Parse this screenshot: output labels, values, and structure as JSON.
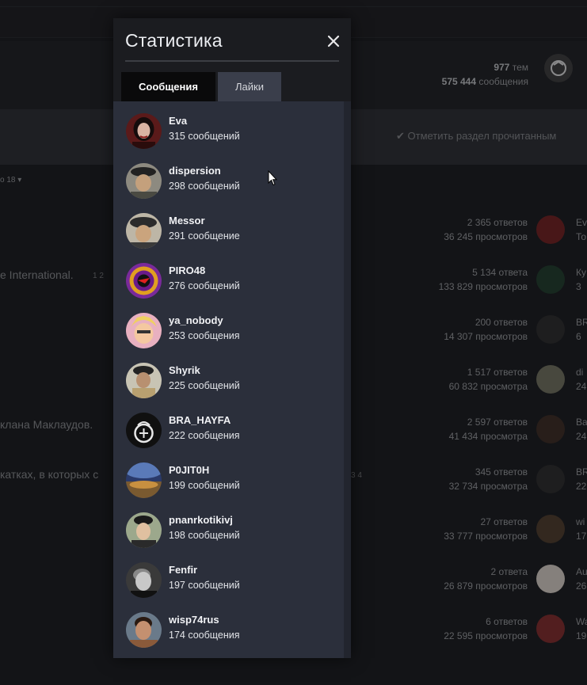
{
  "background": {
    "forum_stats": {
      "topics_value": "977",
      "topics_label": "тем",
      "posts_value": "575 444",
      "posts_label": "сообщения"
    },
    "mark_read": "✔ Отметить раздел прочитанным",
    "sort_fragment": "о 18 ▾",
    "rows": [
      {
        "title": "",
        "pages": "",
        "replies": "2 365 ответов",
        "views": "36 245 просмотров",
        "user": "Ev",
        "sub": "То"
      },
      {
        "title": "e International.",
        "pages": "1  2",
        "replies": "5 134 ответа",
        "views": "133 829 просмотров",
        "user": "Ку",
        "sub": "3"
      },
      {
        "title": "",
        "pages": "",
        "replies": "200 ответов",
        "views": "14 307 просмотров",
        "user": "BR",
        "sub": "6"
      },
      {
        "title": "",
        "pages": "",
        "replies": "1 517 ответов",
        "views": "60 832 просмотра",
        "user": "di",
        "sub": "24"
      },
      {
        "title": "клана Маклаудов.",
        "pages": "",
        "replies": "2 597 ответов",
        "views": "41 434 просмотра",
        "user": "Ba",
        "sub": "24"
      },
      {
        "title": "катках, в которых с",
        "pages": "3  4",
        "replies": "345 ответов",
        "views": "32 734 просмотра",
        "user": "BR",
        "sub": "22"
      },
      {
        "title": "",
        "pages": "",
        "replies": "27 ответов",
        "views": "33 777 просмотров",
        "user": "wi",
        "sub": "17"
      },
      {
        "title": "",
        "pages": "",
        "replies": "2 ответа",
        "views": "26 879 просмотров",
        "user": "Au",
        "sub": "26"
      },
      {
        "title": "",
        "pages": "",
        "replies": "6 ответов",
        "views": "22 595 просмотров",
        "user": "Wa",
        "sub": "19"
      }
    ]
  },
  "modal": {
    "title": "Статистика",
    "close_icon": "close-icon",
    "tabs": [
      {
        "label": "Сообщения",
        "active": true
      },
      {
        "label": "Лайки",
        "active": false
      }
    ],
    "items": [
      {
        "name": "Eva",
        "count": "315 сообщений",
        "avatar": "avatar-eva"
      },
      {
        "name": "dispersion",
        "count": "298 сообщений",
        "avatar": "avatar-dispersion"
      },
      {
        "name": "Messor",
        "count": "291 сообщение",
        "avatar": "avatar-messor"
      },
      {
        "name": "PIRO48",
        "count": "276 сообщений",
        "avatar": "avatar-piro48"
      },
      {
        "name": "ya_nobody",
        "count": "253 сообщения",
        "avatar": "avatar-ya-nobody"
      },
      {
        "name": "Shyrik",
        "count": "225 сообщений",
        "avatar": "avatar-shyrik"
      },
      {
        "name": "BRA_HAYFA",
        "count": "222 сообщения",
        "avatar": "avatar-bra-hayfa"
      },
      {
        "name": "P0JIT0H",
        "count": "199 сообщений",
        "avatar": "avatar-p0jit0h"
      },
      {
        "name": "pnanrkotikivj",
        "count": "198 сообщений",
        "avatar": "avatar-pnanrkotikivj"
      },
      {
        "name": "Fenfir",
        "count": "197 сообщений",
        "avatar": "avatar-fenfir"
      },
      {
        "name": "wisp74rus",
        "count": "174 сообщения",
        "avatar": "avatar-wisp74rus"
      }
    ]
  },
  "colors": {
    "modal_header": "#1b1c20",
    "modal_body": "#2b2f3b",
    "tab_active": "#0a0a0b",
    "tab_inactive": "#3a3e4b",
    "page_bg": "#1a1b1e"
  }
}
